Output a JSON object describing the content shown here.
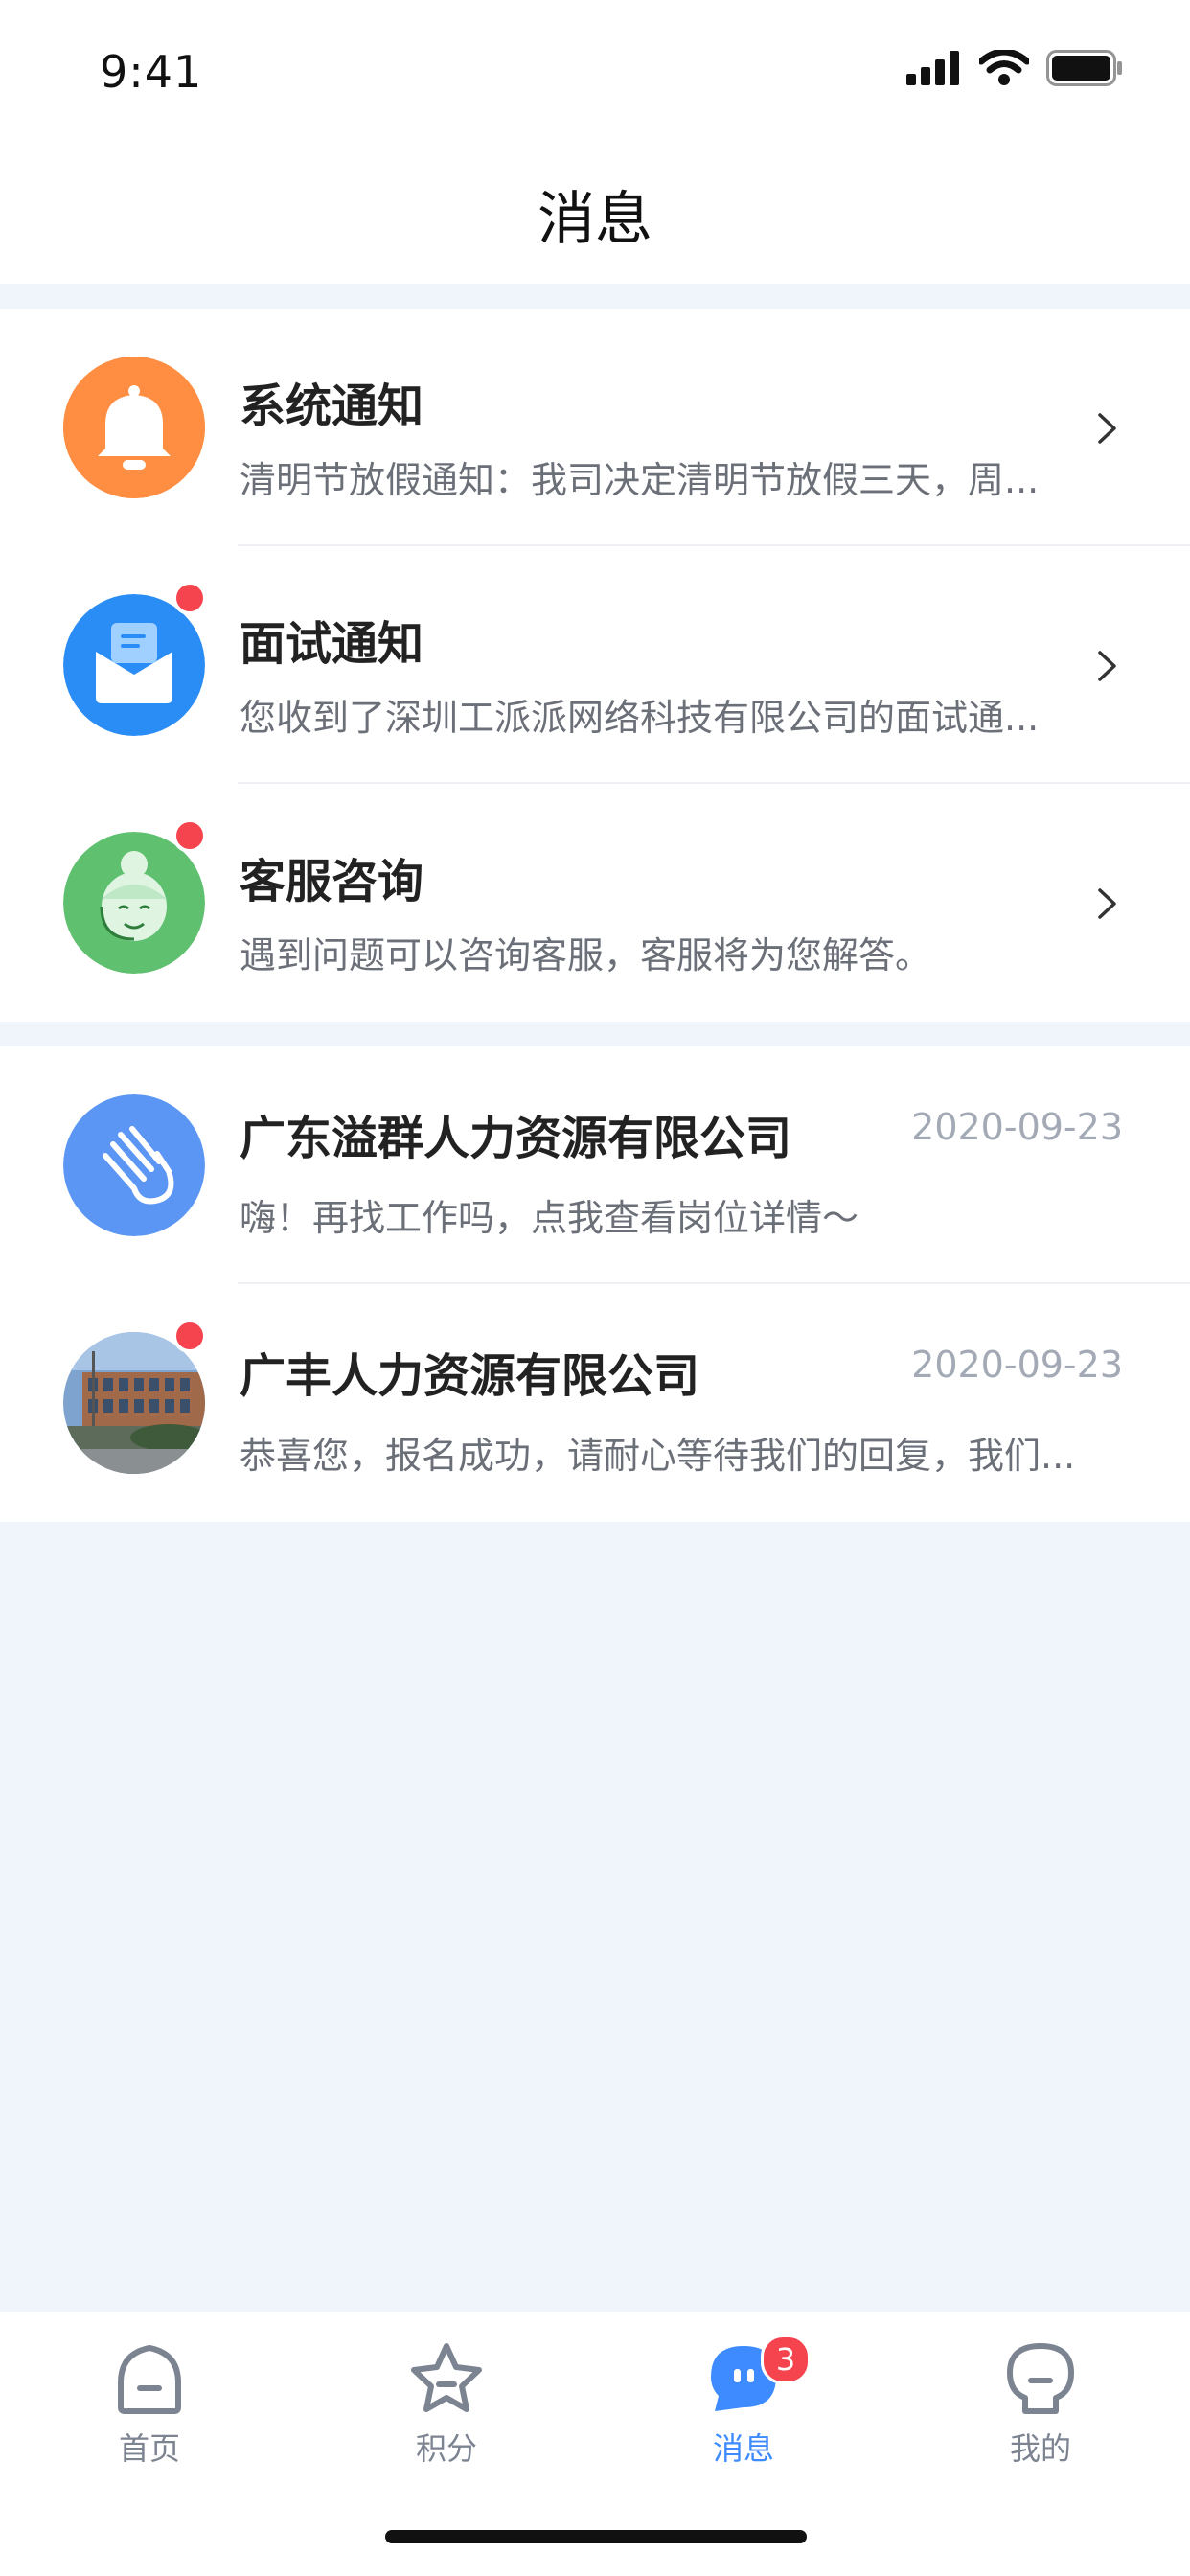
{
  "status_bar": {
    "time": "9:41"
  },
  "nav": {
    "title": "消息"
  },
  "system_rows": [
    {
      "title": "系统通知",
      "subtitle": "清明节放假通知：我司决定清明节放假三天，周...",
      "icon": "bell-icon",
      "color": "#ff8a3c",
      "unread": false
    },
    {
      "title": "面试通知",
      "subtitle": "您收到了深圳工派派网络科技有限公司的面试通...",
      "icon": "envelope-icon",
      "color": "#2a8cf5",
      "unread": true
    },
    {
      "title": "客服咨询",
      "subtitle": "遇到问题可以咨询客服，客服将为您解答。",
      "icon": "customer-service-icon",
      "color": "#5fc06f",
      "unread": true
    }
  ],
  "company_rows": [
    {
      "title": "广东溢群人力资源有限公司",
      "date": "2020-09-23",
      "subtitle": "嗨！再找工作吗，点我查看岗位详情～",
      "icon": "waving-hand-icon",
      "color": "#5b96f5",
      "unread": false
    },
    {
      "title": "广丰人力资源有限公司",
      "date": "2020-09-23",
      "subtitle": "恭喜您，报名成功，请耐心等待我们的回复，我们...",
      "icon": "building-photo",
      "unread": true
    }
  ],
  "tabbar": {
    "tabs": [
      {
        "label": "首页",
        "icon": "home-icon",
        "active": false
      },
      {
        "label": "积分",
        "icon": "star-icon",
        "active": false
      },
      {
        "label": "消息",
        "icon": "message-icon",
        "active": true,
        "badge": "3"
      },
      {
        "label": "我的",
        "icon": "profile-icon",
        "active": false
      }
    ]
  },
  "colors": {
    "accent": "#3d8bff",
    "badge": "#f5444e",
    "background": "#f0f4fb"
  }
}
